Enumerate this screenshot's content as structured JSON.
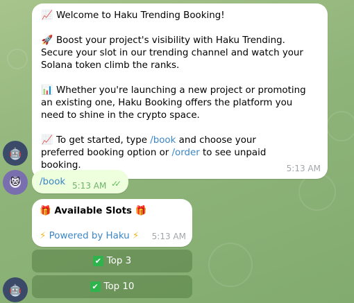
{
  "messages": {
    "welcome": {
      "p1_icon": "📈",
      "p1_text": "Welcome to Haku Trending Booking!",
      "p2_icon": "🚀",
      "p2_text": "Boost your project's visibility with Haku Trending. Secure your slot in our trending channel and watch your Solana token climb the ranks.",
      "p3_icon": "📊",
      "p3_text": "Whether you're launching a new project or promoting an existing one, Haku Booking offers the platform you need to shine in the crypto space.",
      "p4_icon": "📈",
      "p4_prefix": "To get started, type ",
      "p4_cmd1": "/book",
      "p4_middle": " and choose your preferred booking option or ",
      "p4_cmd2": "/order",
      "p4_suffix": " to see unpaid booking.",
      "time": "5:13 AM"
    },
    "user_command": {
      "text": "/book",
      "time": "5:13 AM",
      "status": "read"
    },
    "slots": {
      "gift_icon": "🎁",
      "title": "Available Slots",
      "bolt_icon": "⚡",
      "powered_by": "Powered by Haku",
      "time": "5:13 AM"
    }
  },
  "keyboard": {
    "buttons": [
      {
        "icon": "✔",
        "label": "Top 3"
      },
      {
        "icon": "✔",
        "label": "Top 10"
      }
    ]
  },
  "colors": {
    "link": "#3a86c6",
    "user_bubble": "#eeffde",
    "read_ticks": "#5fbf5a",
    "check_badge": "#2fb34d"
  }
}
